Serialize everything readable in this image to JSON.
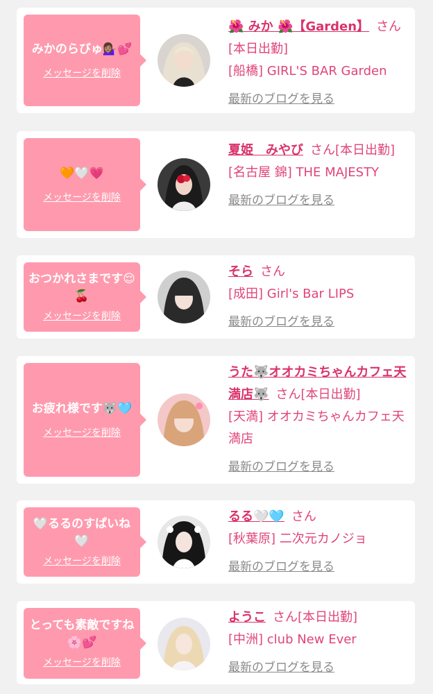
{
  "entries": [
    {
      "message": "みかのらびゅ💁🏽‍♀️💕",
      "delete_label": "メッセージを削除",
      "name": "🌺 みか 🌺【Garden】",
      "honorific": "さん",
      "status": "[本日出勤]",
      "shop": "[船橋] GIRL'S BAR Garden",
      "blog_label": "最新のブログを見る"
    },
    {
      "message": "🧡🤍💗",
      "delete_label": "メッセージを削除",
      "name": "夏姫　みやび",
      "honorific": "さん",
      "status": "[本日出勤]",
      "shop": "[名古屋 錦] THE MAJESTY",
      "blog_label": "最新のブログを見る"
    },
    {
      "message": "おつかれさまです😌🍒",
      "delete_label": "メッセージを削除",
      "name": "そら",
      "honorific": "さん",
      "status": "",
      "shop": "[成田] Girl's Bar LIPS",
      "blog_label": "最新のブログを見る"
    },
    {
      "message": "お疲れ様です🐺🩵",
      "delete_label": "メッセージを削除",
      "name": "うた🐺オオカミちゃんカフェ天満店🐺",
      "honorific": "さん",
      "status": "[本日出勤]",
      "shop": "[天満] オオカミちゃんカフェ天満店",
      "blog_label": "最新のブログを見る"
    },
    {
      "message": "🤍るるのすぱいね🤍",
      "delete_label": "メッセージを削除",
      "name": "るる🤍🩵",
      "honorific": "さん",
      "status": "",
      "shop": "[秋葉原] 二次元カノジョ",
      "blog_label": "最新のブログを見る"
    },
    {
      "message": "とっても素敵ですね🌸💕",
      "delete_label": "メッセージを削除",
      "name": "ようこ",
      "honorific": "さん",
      "status": "[本日出勤]",
      "shop": "[中洲] club New Ever",
      "blog_label": "最新のブログを見る"
    }
  ],
  "colors": {
    "background": "#f1f1f1",
    "card": "#ffffff",
    "bubble": "#ff9aae",
    "accent": "#e0447a",
    "link_gray": "#8a8a8a"
  }
}
